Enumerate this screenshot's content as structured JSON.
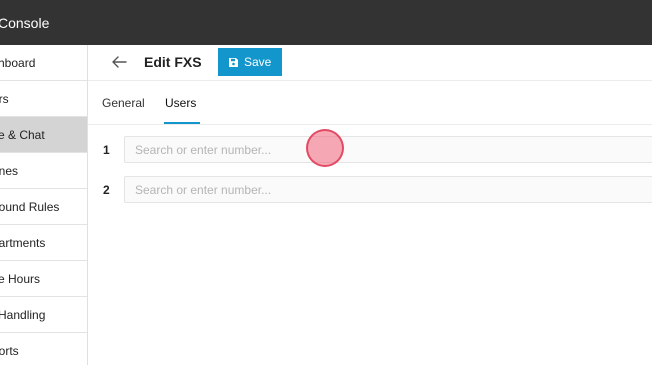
{
  "app": {
    "title": "Console"
  },
  "sidebar": {
    "items": [
      {
        "label": "shboard",
        "active": false
      },
      {
        "label": "ers",
        "active": false
      },
      {
        "label": "ce & Chat",
        "active": true
      },
      {
        "label": "ones",
        "active": false
      },
      {
        "label": "bound Rules",
        "active": false
      },
      {
        "label": "partments",
        "active": false
      },
      {
        "label": "ce Hours",
        "active": false
      },
      {
        "label": "l Handling",
        "active": false
      },
      {
        "label": "ports",
        "active": false
      }
    ]
  },
  "header": {
    "title": "Edit FXS",
    "save_label": "Save"
  },
  "tabs": [
    {
      "label": "General",
      "active": false
    },
    {
      "label": "Users",
      "active": true
    }
  ],
  "users": [
    {
      "index": "1",
      "placeholder": "Search or enter number...",
      "value": ""
    },
    {
      "index": "2",
      "placeholder": "Search or enter number...",
      "value": ""
    }
  ],
  "colors": {
    "accent": "#1296cc",
    "topbar": "#333333",
    "active_item": "#d4d4d4"
  }
}
